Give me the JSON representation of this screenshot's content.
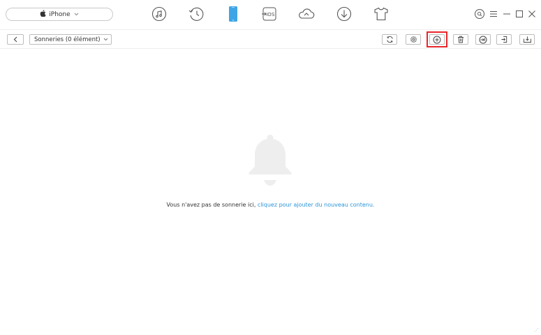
{
  "device": {
    "name": "iPhone",
    "chevron_icon": "chevron-down-icon"
  },
  "nav_icons": [
    "music-icon",
    "history-icon",
    "phone-icon",
    "ios-icon",
    "cloud-icon",
    "download-icon",
    "tshirt-icon"
  ],
  "window_controls": [
    "search-icon",
    "menu-icon",
    "minimize-icon",
    "maximize-icon",
    "close-icon"
  ],
  "toolbar": {
    "category": "Sonneries (0 élément)",
    "buttons": [
      "refresh-icon",
      "settings-icon",
      "add-icon",
      "delete-icon",
      "to-itunes-icon",
      "to-pc-icon",
      "to-device-icon"
    ]
  },
  "empty_state": {
    "icon": "bell-icon",
    "message": "Vous n'avez pas de sonnerie ici, ",
    "link": "cliquez pour ajouter du nouveau contenu."
  },
  "colors": {
    "accent_blue": "#2b95d8",
    "highlight_red": "#e8262a",
    "icon_gray": "#555555",
    "bell_gray": "#eeeeee"
  }
}
